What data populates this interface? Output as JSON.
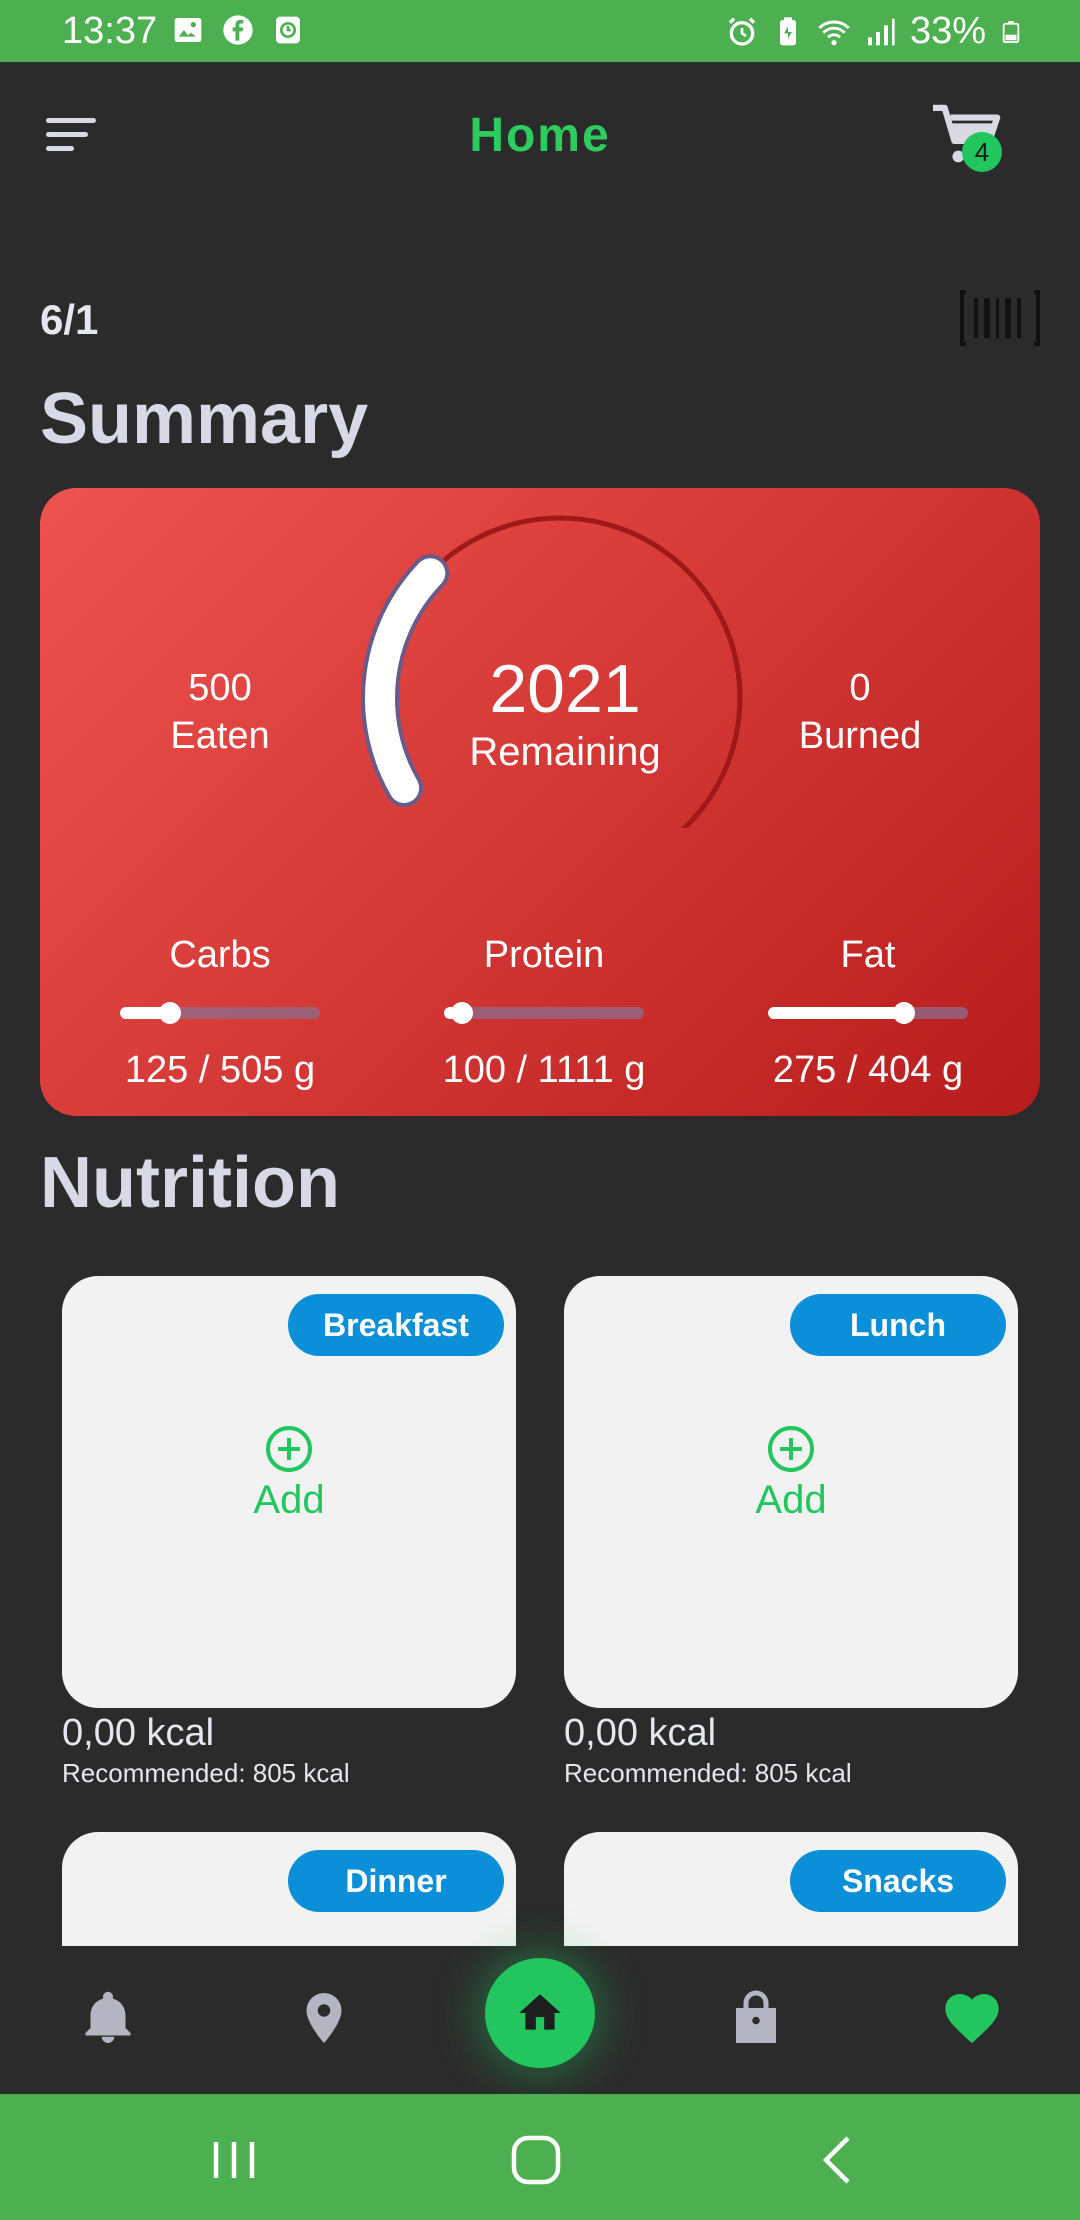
{
  "status_bar": {
    "time": "13:37",
    "battery": "33%",
    "icons": [
      "image-icon",
      "facebook-icon",
      "clock-app-icon",
      "alarm-icon",
      "battery-saver-icon",
      "wifi-icon",
      "signal-icon",
      "battery-icon"
    ]
  },
  "header": {
    "title": "Home",
    "cart_count": "4",
    "accent": "#2ecc5f"
  },
  "date": "6/1",
  "summary": {
    "heading": "Summary",
    "eaten_value": "500",
    "eaten_label": "Eaten",
    "remaining_value": "2021",
    "remaining_label": "Remaining",
    "burned_value": "0",
    "burned_label": "Burned",
    "remaining_fraction": 0.2,
    "macros": [
      {
        "label": "Carbs",
        "value": "125  / 505 g",
        "fraction": 0.25
      },
      {
        "label": "Protein",
        "value": "100  / 1111 g",
        "fraction": 0.09
      },
      {
        "label": "Fat",
        "value": "275  / 404 g",
        "fraction": 0.68
      }
    ],
    "card_color": "#e53935"
  },
  "nutrition": {
    "heading": "Nutrition",
    "meals": [
      {
        "name": "Breakfast",
        "add_label": "Add",
        "kcal": "0,00 kcal",
        "recommended": "Recommended: 805 kcal"
      },
      {
        "name": "Lunch",
        "add_label": "Add",
        "kcal": "0,00 kcal",
        "recommended": "Recommended: 805 kcal"
      },
      {
        "name": "Dinner"
      },
      {
        "name": "Snacks"
      }
    ],
    "pill_color": "#0b8fd9"
  },
  "bottom_nav": {
    "items": [
      "notifications-icon",
      "location-icon",
      "home-icon",
      "shopping-bag-icon",
      "favorites-heart-icon"
    ],
    "active": "home-icon"
  },
  "system_nav": [
    "recents-button",
    "home-button",
    "back-button"
  ]
}
